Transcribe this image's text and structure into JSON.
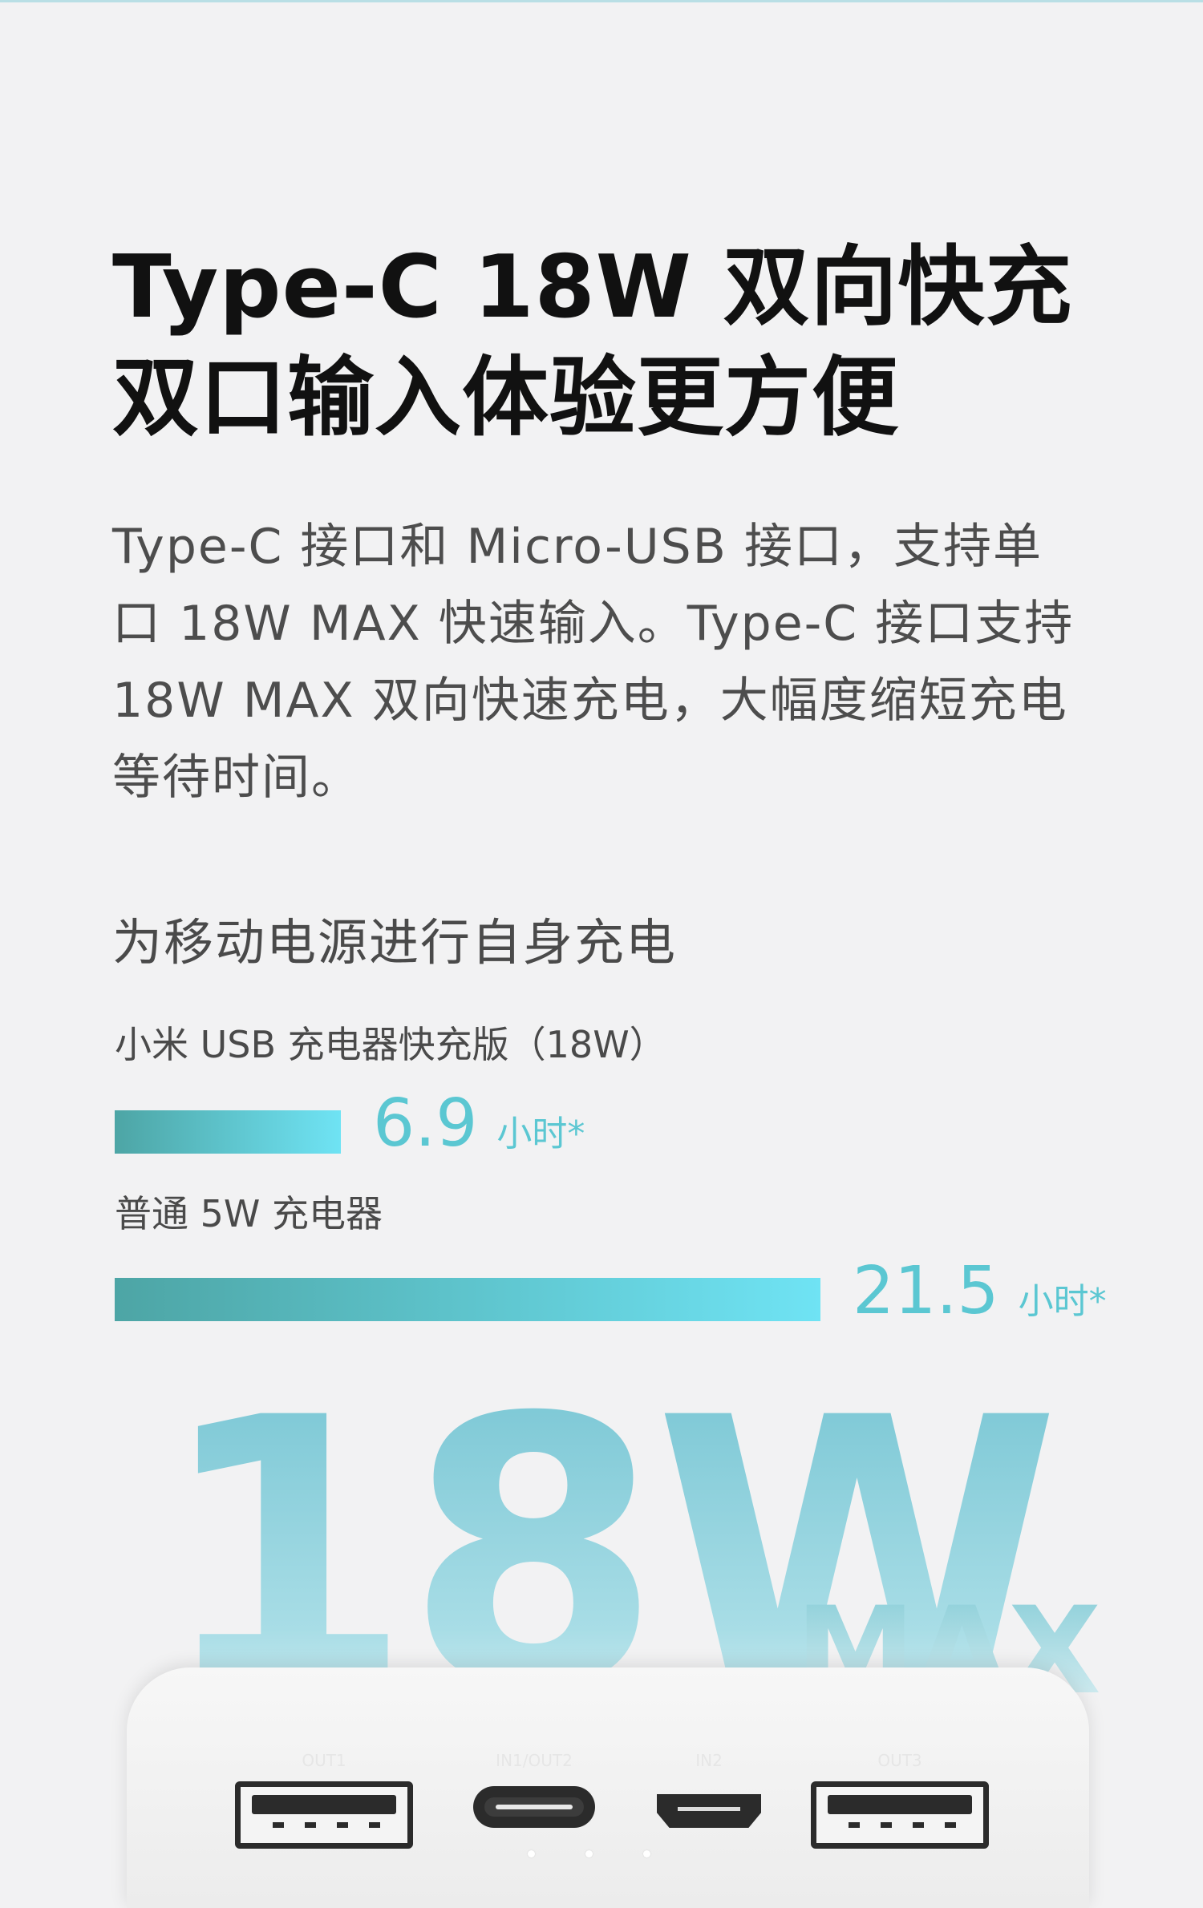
{
  "headline": {
    "line1": "Type-C 18W 双向快充",
    "line2": "双口输入体验更方便"
  },
  "body": {
    "description": "Type-C 接口和 Micro-USB 接口，支持单口 18W MAX 快速输入。Type-C 接口支持 18W MAX 双向快速充电，大幅度缩短充电等待时间。"
  },
  "section": {
    "title": "为移动电源进行自身充电"
  },
  "chart_data": {
    "type": "bar",
    "title": "为移动电源进行自身充电",
    "categories": [
      "小米 USB 充电器快充版（18W）",
      "普通 5W 充电器"
    ],
    "values": [
      6.9,
      21.5
    ],
    "unit": "小时*",
    "colors": {
      "bar_start": "#4da5a5",
      "bar_end": "#6fe3f4",
      "value_text": "#5bc7d2"
    }
  },
  "hero": {
    "number": "18W",
    "suffix": "MAX"
  },
  "device": {
    "ports": [
      {
        "label": "OUT1",
        "type": "usb-a"
      },
      {
        "label": "IN1/OUT2",
        "type": "usb-c"
      },
      {
        "label": "IN2",
        "type": "micro-usb"
      },
      {
        "label": "OUT3",
        "type": "usb-a"
      }
    ]
  }
}
